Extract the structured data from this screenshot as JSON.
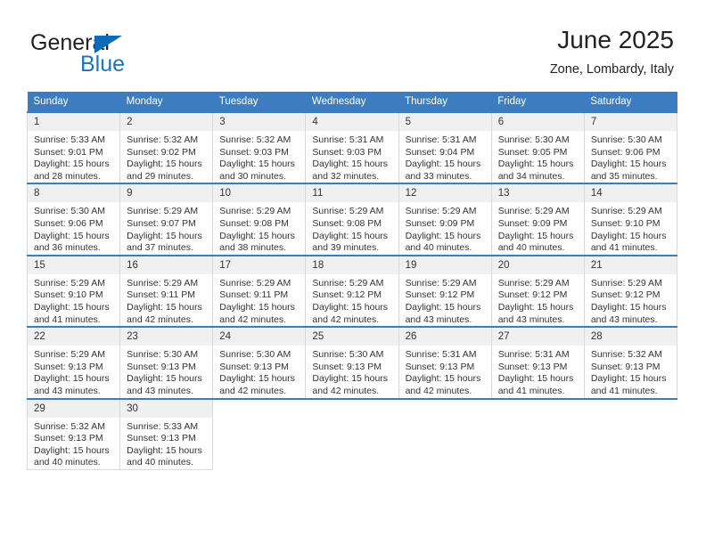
{
  "brand": {
    "name_part1": "General",
    "name_part2": "Blue",
    "accent_color": "#1b75bc",
    "triangle_color": "#0d6cb9"
  },
  "header": {
    "title": "June 2025",
    "subtitle": "Zone, Lombardy, Italy"
  },
  "calendar": {
    "header_bg": "#3d7dbf",
    "daynum_bg": "#f0f0f0",
    "weekdays": [
      "Sunday",
      "Monday",
      "Tuesday",
      "Wednesday",
      "Thursday",
      "Friday",
      "Saturday"
    ],
    "weeks": [
      [
        {
          "day": "1",
          "sunrise": "Sunrise: 5:33 AM",
          "sunset": "Sunset: 9:01 PM",
          "daylight1": "Daylight: 15 hours",
          "daylight2": "and 28 minutes."
        },
        {
          "day": "2",
          "sunrise": "Sunrise: 5:32 AM",
          "sunset": "Sunset: 9:02 PM",
          "daylight1": "Daylight: 15 hours",
          "daylight2": "and 29 minutes."
        },
        {
          "day": "3",
          "sunrise": "Sunrise: 5:32 AM",
          "sunset": "Sunset: 9:03 PM",
          "daylight1": "Daylight: 15 hours",
          "daylight2": "and 30 minutes."
        },
        {
          "day": "4",
          "sunrise": "Sunrise: 5:31 AM",
          "sunset": "Sunset: 9:03 PM",
          "daylight1": "Daylight: 15 hours",
          "daylight2": "and 32 minutes."
        },
        {
          "day": "5",
          "sunrise": "Sunrise: 5:31 AM",
          "sunset": "Sunset: 9:04 PM",
          "daylight1": "Daylight: 15 hours",
          "daylight2": "and 33 minutes."
        },
        {
          "day": "6",
          "sunrise": "Sunrise: 5:30 AM",
          "sunset": "Sunset: 9:05 PM",
          "daylight1": "Daylight: 15 hours",
          "daylight2": "and 34 minutes."
        },
        {
          "day": "7",
          "sunrise": "Sunrise: 5:30 AM",
          "sunset": "Sunset: 9:06 PM",
          "daylight1": "Daylight: 15 hours",
          "daylight2": "and 35 minutes."
        }
      ],
      [
        {
          "day": "8",
          "sunrise": "Sunrise: 5:30 AM",
          "sunset": "Sunset: 9:06 PM",
          "daylight1": "Daylight: 15 hours",
          "daylight2": "and 36 minutes."
        },
        {
          "day": "9",
          "sunrise": "Sunrise: 5:29 AM",
          "sunset": "Sunset: 9:07 PM",
          "daylight1": "Daylight: 15 hours",
          "daylight2": "and 37 minutes."
        },
        {
          "day": "10",
          "sunrise": "Sunrise: 5:29 AM",
          "sunset": "Sunset: 9:08 PM",
          "daylight1": "Daylight: 15 hours",
          "daylight2": "and 38 minutes."
        },
        {
          "day": "11",
          "sunrise": "Sunrise: 5:29 AM",
          "sunset": "Sunset: 9:08 PM",
          "daylight1": "Daylight: 15 hours",
          "daylight2": "and 39 minutes."
        },
        {
          "day": "12",
          "sunrise": "Sunrise: 5:29 AM",
          "sunset": "Sunset: 9:09 PM",
          "daylight1": "Daylight: 15 hours",
          "daylight2": "and 40 minutes."
        },
        {
          "day": "13",
          "sunrise": "Sunrise: 5:29 AM",
          "sunset": "Sunset: 9:09 PM",
          "daylight1": "Daylight: 15 hours",
          "daylight2": "and 40 minutes."
        },
        {
          "day": "14",
          "sunrise": "Sunrise: 5:29 AM",
          "sunset": "Sunset: 9:10 PM",
          "daylight1": "Daylight: 15 hours",
          "daylight2": "and 41 minutes."
        }
      ],
      [
        {
          "day": "15",
          "sunrise": "Sunrise: 5:29 AM",
          "sunset": "Sunset: 9:10 PM",
          "daylight1": "Daylight: 15 hours",
          "daylight2": "and 41 minutes."
        },
        {
          "day": "16",
          "sunrise": "Sunrise: 5:29 AM",
          "sunset": "Sunset: 9:11 PM",
          "daylight1": "Daylight: 15 hours",
          "daylight2": "and 42 minutes."
        },
        {
          "day": "17",
          "sunrise": "Sunrise: 5:29 AM",
          "sunset": "Sunset: 9:11 PM",
          "daylight1": "Daylight: 15 hours",
          "daylight2": "and 42 minutes."
        },
        {
          "day": "18",
          "sunrise": "Sunrise: 5:29 AM",
          "sunset": "Sunset: 9:12 PM",
          "daylight1": "Daylight: 15 hours",
          "daylight2": "and 42 minutes."
        },
        {
          "day": "19",
          "sunrise": "Sunrise: 5:29 AM",
          "sunset": "Sunset: 9:12 PM",
          "daylight1": "Daylight: 15 hours",
          "daylight2": "and 43 minutes."
        },
        {
          "day": "20",
          "sunrise": "Sunrise: 5:29 AM",
          "sunset": "Sunset: 9:12 PM",
          "daylight1": "Daylight: 15 hours",
          "daylight2": "and 43 minutes."
        },
        {
          "day": "21",
          "sunrise": "Sunrise: 5:29 AM",
          "sunset": "Sunset: 9:12 PM",
          "daylight1": "Daylight: 15 hours",
          "daylight2": "and 43 minutes."
        }
      ],
      [
        {
          "day": "22",
          "sunrise": "Sunrise: 5:29 AM",
          "sunset": "Sunset: 9:13 PM",
          "daylight1": "Daylight: 15 hours",
          "daylight2": "and 43 minutes."
        },
        {
          "day": "23",
          "sunrise": "Sunrise: 5:30 AM",
          "sunset": "Sunset: 9:13 PM",
          "daylight1": "Daylight: 15 hours",
          "daylight2": "and 43 minutes."
        },
        {
          "day": "24",
          "sunrise": "Sunrise: 5:30 AM",
          "sunset": "Sunset: 9:13 PM",
          "daylight1": "Daylight: 15 hours",
          "daylight2": "and 42 minutes."
        },
        {
          "day": "25",
          "sunrise": "Sunrise: 5:30 AM",
          "sunset": "Sunset: 9:13 PM",
          "daylight1": "Daylight: 15 hours",
          "daylight2": "and 42 minutes."
        },
        {
          "day": "26",
          "sunrise": "Sunrise: 5:31 AM",
          "sunset": "Sunset: 9:13 PM",
          "daylight1": "Daylight: 15 hours",
          "daylight2": "and 42 minutes."
        },
        {
          "day": "27",
          "sunrise": "Sunrise: 5:31 AM",
          "sunset": "Sunset: 9:13 PM",
          "daylight1": "Daylight: 15 hours",
          "daylight2": "and 41 minutes."
        },
        {
          "day": "28",
          "sunrise": "Sunrise: 5:32 AM",
          "sunset": "Sunset: 9:13 PM",
          "daylight1": "Daylight: 15 hours",
          "daylight2": "and 41 minutes."
        }
      ],
      [
        {
          "day": "29",
          "sunrise": "Sunrise: 5:32 AM",
          "sunset": "Sunset: 9:13 PM",
          "daylight1": "Daylight: 15 hours",
          "daylight2": "and 40 minutes."
        },
        {
          "day": "30",
          "sunrise": "Sunrise: 5:33 AM",
          "sunset": "Sunset: 9:13 PM",
          "daylight1": "Daylight: 15 hours",
          "daylight2": "and 40 minutes."
        },
        null,
        null,
        null,
        null,
        null
      ]
    ]
  }
}
